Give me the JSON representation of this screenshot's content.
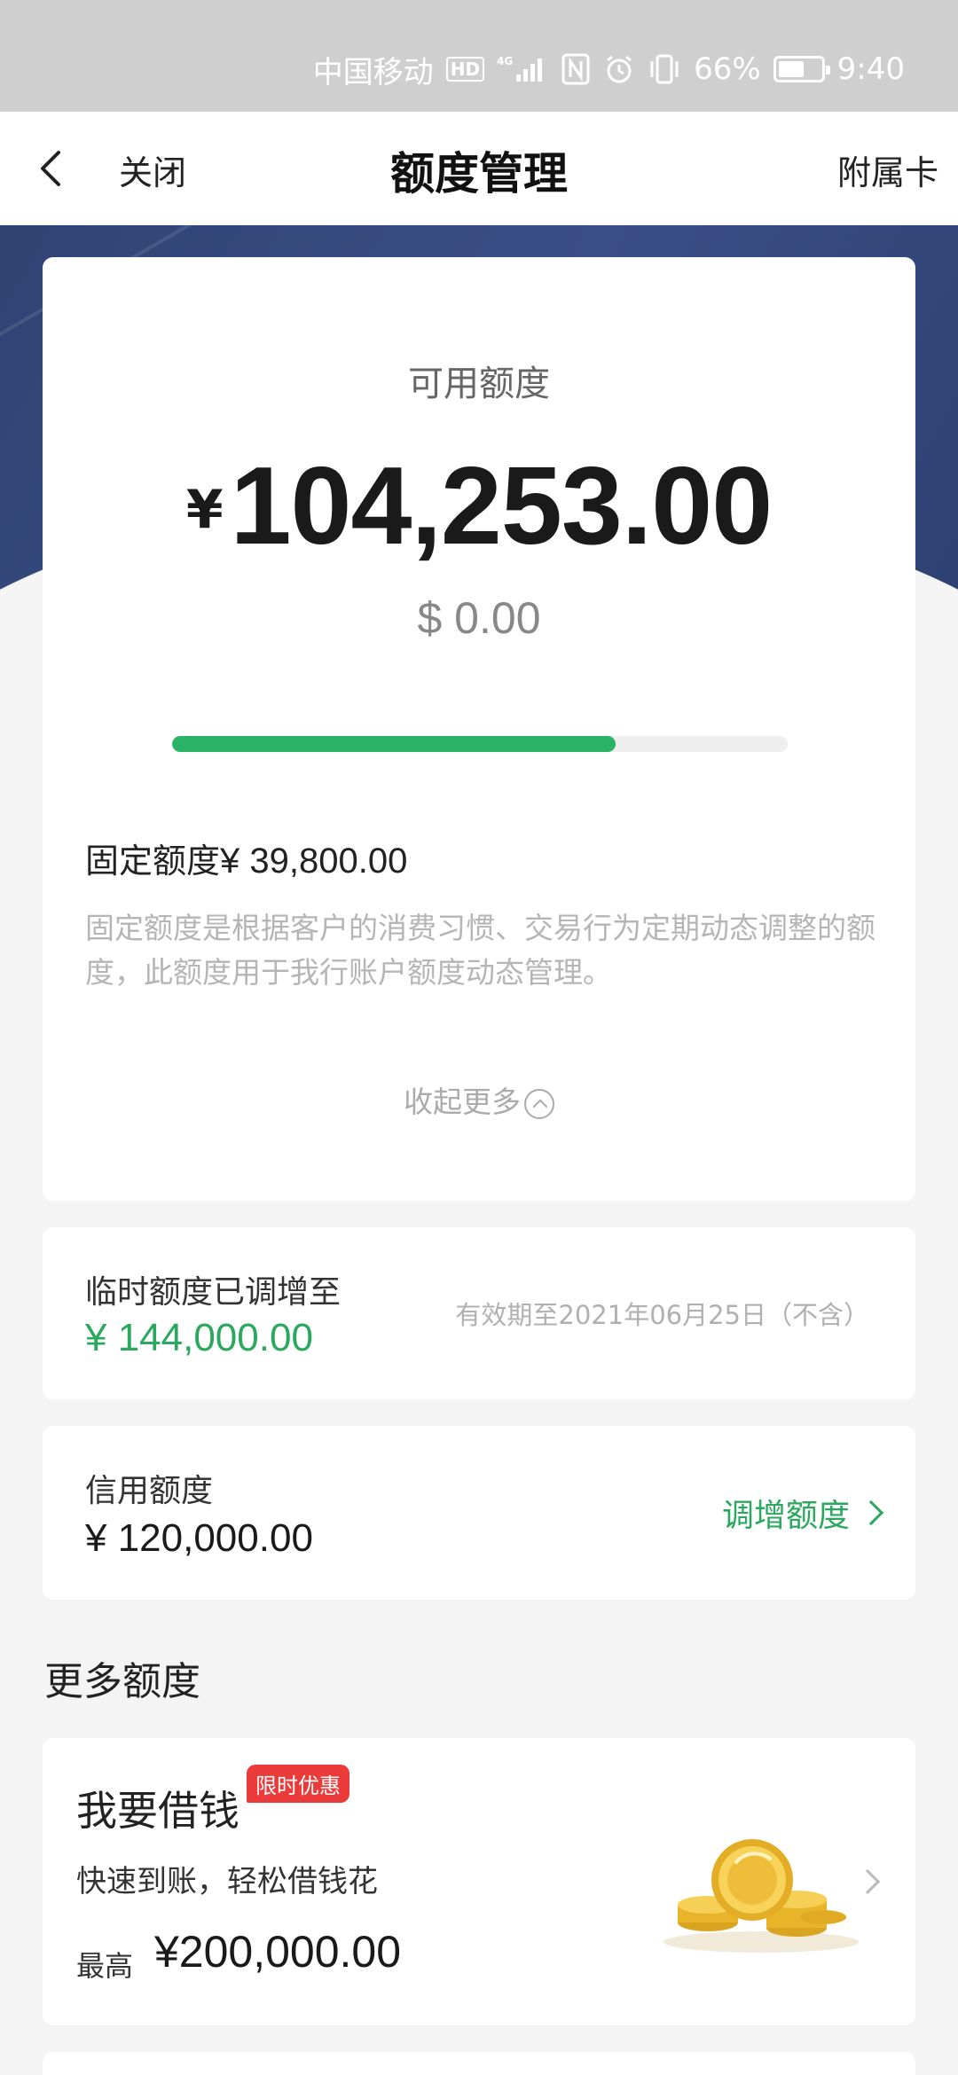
{
  "status_bar": {
    "carrier": "中国移动",
    "hd": "HD",
    "network": "4G",
    "battery_text": "66%",
    "battery_level": 0.66,
    "time": "9:40"
  },
  "nav": {
    "close_label": "关闭",
    "title": "额度管理",
    "right_label": "附属卡"
  },
  "available": {
    "label": "可用额度",
    "currency_symbol": "¥",
    "amount": "104,253.00",
    "usd_amount": "$ 0.00",
    "progress": 0.72
  },
  "fixed_limit": {
    "label": "固定额度",
    "amount": "¥ 39,800.00",
    "description": "固定额度是根据客户的消费习惯、交易行为定期动态调整的额度，此额度用于我行账户额度动态管理。",
    "collapse_label": "收起更多"
  },
  "temporary_limit": {
    "label": "临时额度已调增至",
    "amount": "¥ 144,000.00",
    "validity": "有效期至2021年06月25日（不含）"
  },
  "credit_limit": {
    "label": "信用额度",
    "amount": "¥ 120,000.00",
    "action_label": "调增额度"
  },
  "more_section": {
    "title": "更多额度"
  },
  "loan": {
    "title": "我要借钱",
    "badge": "限时优惠",
    "subtitle": "快速到账，轻松借钱花",
    "max_label": "最高",
    "max_amount": "¥200,000.00"
  },
  "colors": {
    "accent_green": "#2ab267",
    "banner_blue": "#34487c",
    "badge_red": "#ea3a3a"
  }
}
